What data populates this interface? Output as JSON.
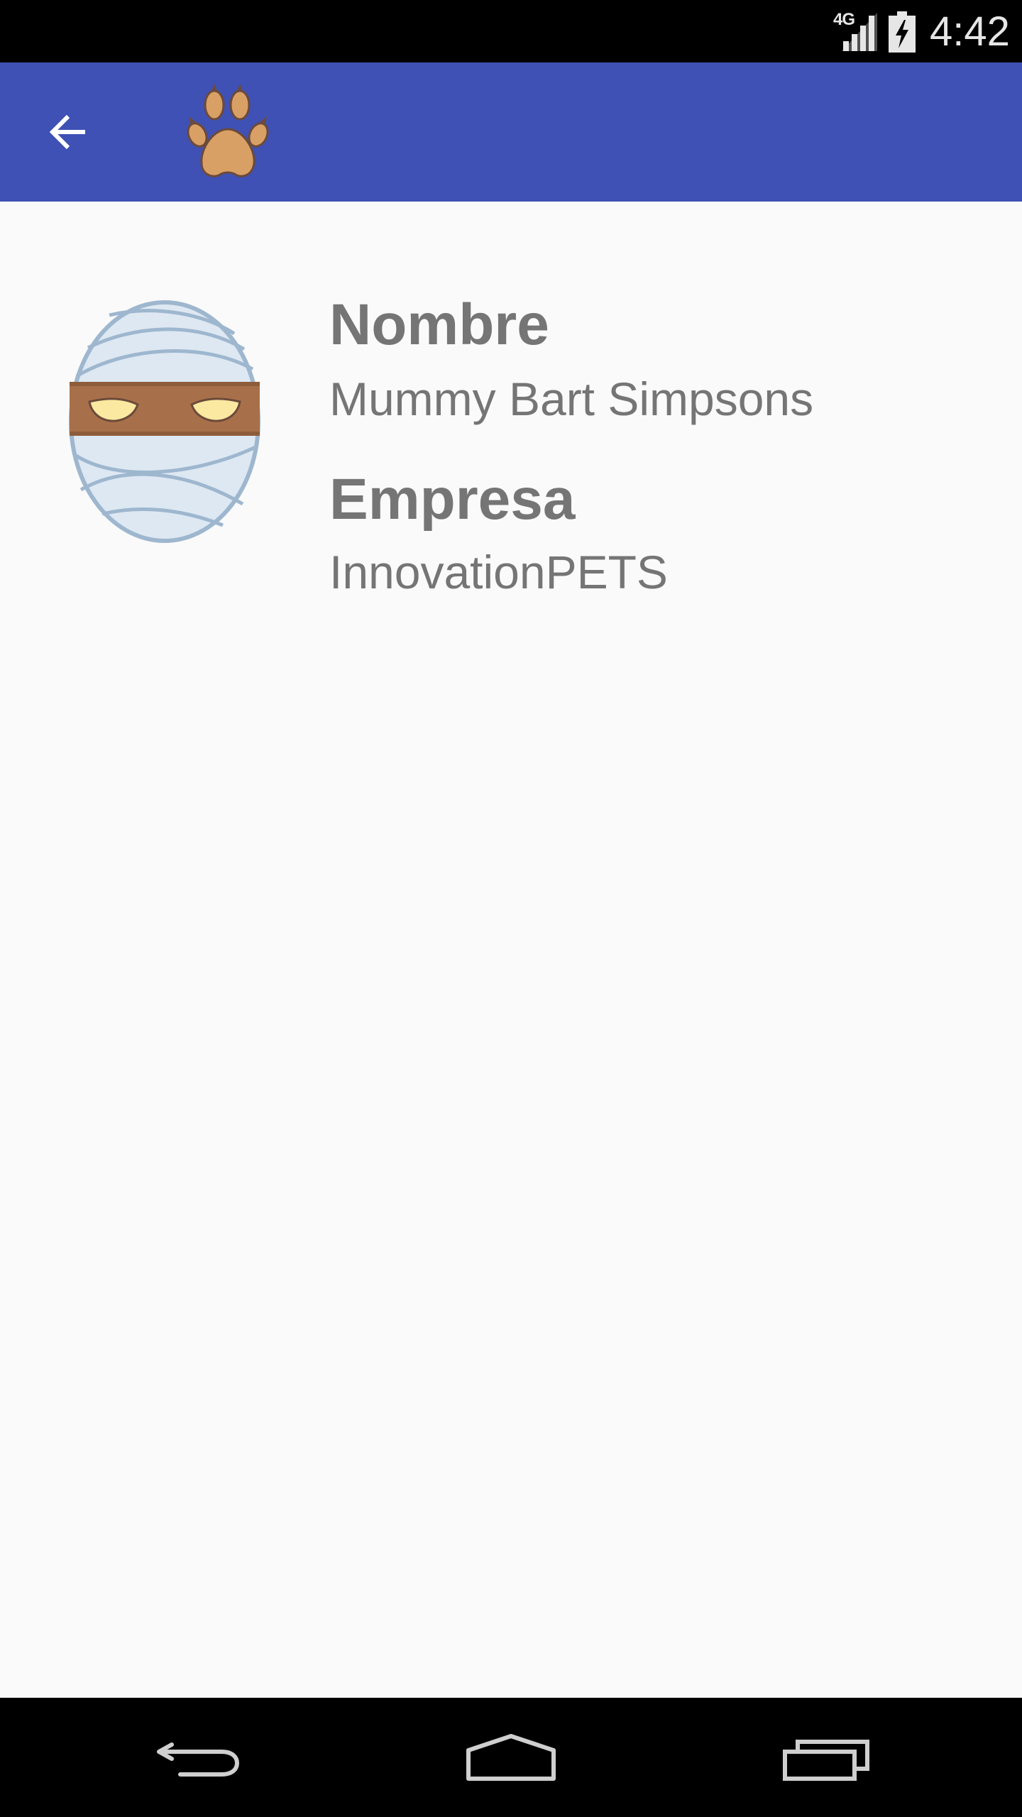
{
  "status_bar": {
    "network": "4G",
    "time": "4:42"
  },
  "toolbar": {
    "back_icon": "arrow-back-icon",
    "logo_icon": "paw-icon",
    "color": "#3f51b5"
  },
  "profile": {
    "avatar_icon": "mummy-avatar",
    "name_label": "Nombre",
    "name_value": "Mummy Bart Simpsons",
    "company_label": "Empresa",
    "company_value": "InnovationPETS"
  },
  "nav_bar": {
    "back_icon": "nav-back-icon",
    "home_icon": "nav-home-icon",
    "recents_icon": "nav-recents-icon"
  }
}
